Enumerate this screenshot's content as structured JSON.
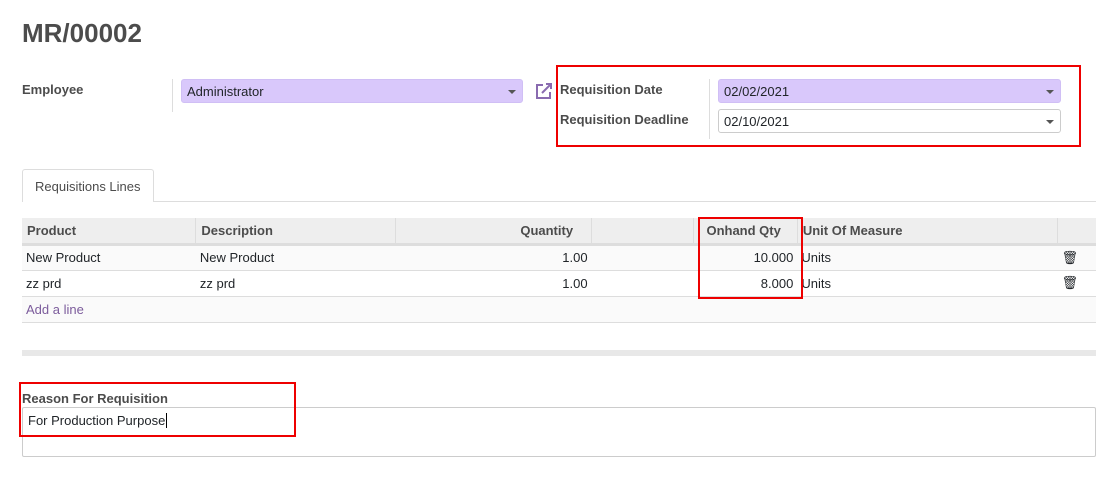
{
  "title": "MR/00002",
  "employee": {
    "label": "Employee",
    "value": "Administrator",
    "external_link_icon": "external-link-icon"
  },
  "requisition_date": {
    "label": "Requisition Date",
    "value": "02/02/2021"
  },
  "requisition_deadline": {
    "label": "Requisition Deadline",
    "value": "02/10/2021"
  },
  "tabs": [
    {
      "label": "Requisitions Lines"
    }
  ],
  "table": {
    "columns": [
      "Product",
      "Description",
      "Quantity",
      "",
      "Onhand Qty",
      "Unit Of Measure",
      ""
    ],
    "rows": [
      {
        "product": "New Product",
        "description": "New Product",
        "quantity": "1.00",
        "onhand": "10.000",
        "uom": "Units"
      },
      {
        "product": "zz prd",
        "description": "zz prd",
        "quantity": "1.00",
        "onhand": "8.000",
        "uom": "Units"
      }
    ],
    "add_line": "Add a line"
  },
  "reason": {
    "label": "Reason For Requisition",
    "value": "For Production Purpose"
  },
  "colors": {
    "required_bg": "#d9c8fb",
    "highlight": "#e00000",
    "link": "#7c5c9c"
  }
}
